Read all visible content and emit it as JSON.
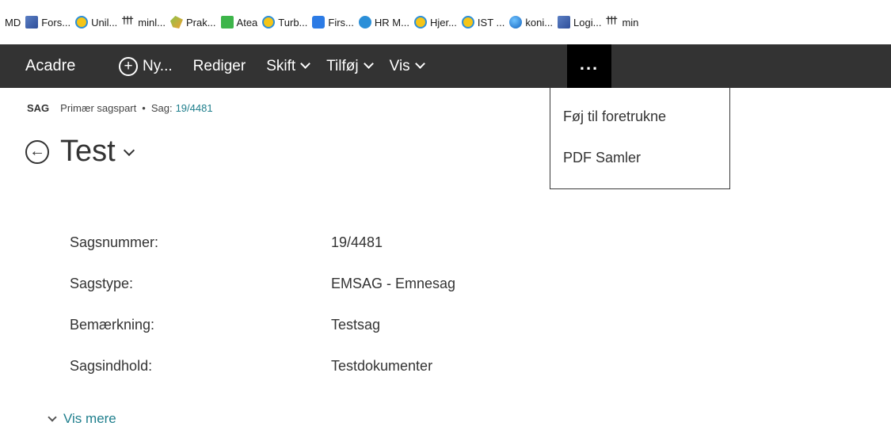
{
  "favorites": [
    {
      "label": "MD",
      "icon": "none"
    },
    {
      "label": "Fors...",
      "icon": "shield-icon"
    },
    {
      "label": "Unil...",
      "icon": "ie-icon"
    },
    {
      "label": "minl...",
      "icon": "people-icon"
    },
    {
      "label": "Prak...",
      "icon": "leaf-icon"
    },
    {
      "label": "Atea",
      "icon": "atea-icon"
    },
    {
      "label": "Turb...",
      "icon": "ie-icon"
    },
    {
      "label": "Firs...",
      "icon": "p-icon"
    },
    {
      "label": "HR M...",
      "icon": "hr-icon"
    },
    {
      "label": "Hjer...",
      "icon": "ie-icon"
    },
    {
      "label": "IST ...",
      "icon": "ie-icon"
    },
    {
      "label": "koni...",
      "icon": "globe-icon"
    },
    {
      "label": "Logi...",
      "icon": "shield-icon"
    },
    {
      "label": "min",
      "icon": "people-icon"
    }
  ],
  "topbar": {
    "brand": "Acadre",
    "new_label": "Ny...",
    "edit_label": "Rediger",
    "switch_label": "Skift",
    "add_label": "Tilføj",
    "view_label": "Vis",
    "more_label": "...",
    "colors": {
      "bar": "#333333",
      "more_active": "#000000"
    }
  },
  "dropdown": {
    "items": [
      "Føj til foretrukne",
      "PDF Samler"
    ]
  },
  "breadcrumb": {
    "tag": "SAG",
    "party": "Primær sagspart",
    "case_prefix": "Sag:",
    "case_number": "19/4481"
  },
  "page": {
    "title": "Test"
  },
  "fields": [
    {
      "label": "Sagsnummer:",
      "value": "19/4481"
    },
    {
      "label": "Sagstype:",
      "value": "EMSAG - Emnesag"
    },
    {
      "label": "Bemærkning:",
      "value": "Testsag"
    },
    {
      "label": "Sagsindhold:",
      "value": "Testdokumenter"
    }
  ],
  "show_more": {
    "label": "Vis mere"
  },
  "colors": {
    "link": "#1e7e8c"
  }
}
